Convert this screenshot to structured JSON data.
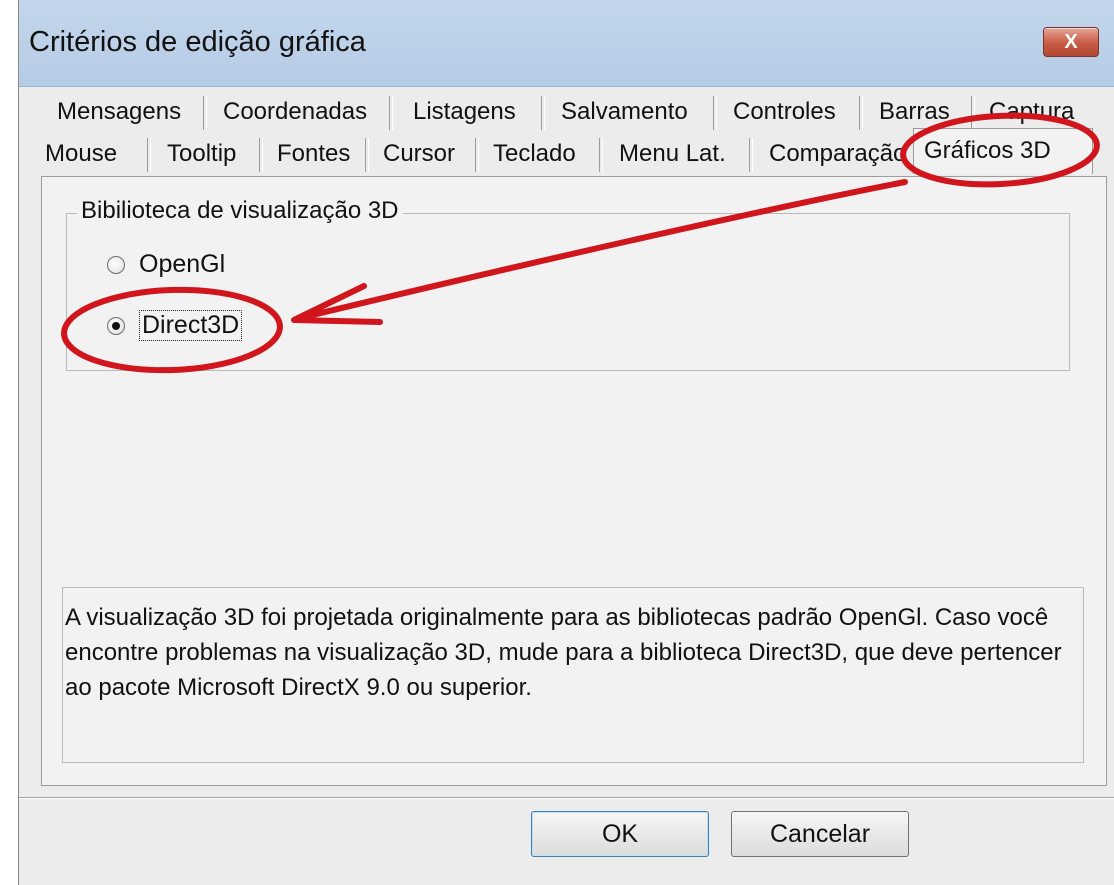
{
  "dialog": {
    "title": "Critérios de edição gráfica",
    "close_label": "X"
  },
  "tabs": {
    "row1": [
      "Mensagens",
      "Coordenadas",
      "Listagens",
      "Salvamento",
      "Controles",
      "Barras",
      "Captura"
    ],
    "row2": [
      "Mouse",
      "Tooltip",
      "Fontes",
      "Cursor",
      "Teclado",
      "Menu Lat.",
      "Comparação",
      "Gráficos 3D"
    ],
    "active": "Gráficos 3D"
  },
  "group": {
    "label": "Bibilioteca de visualização 3D",
    "options": [
      "OpenGl",
      "Direct3D"
    ],
    "selected": "Direct3D"
  },
  "info_text": "A visualização 3D foi projetada originalmente para as bibliotecas padrão OpenGl. Caso você encontre problemas na visualização 3D, mude para a biblioteca Direct3D, que deve pertencer ao pacote Microsoft DirectX 9.0 ou superior.",
  "buttons": {
    "ok": "OK",
    "cancel": "Cancelar"
  },
  "annotation_color": "#d0161c"
}
